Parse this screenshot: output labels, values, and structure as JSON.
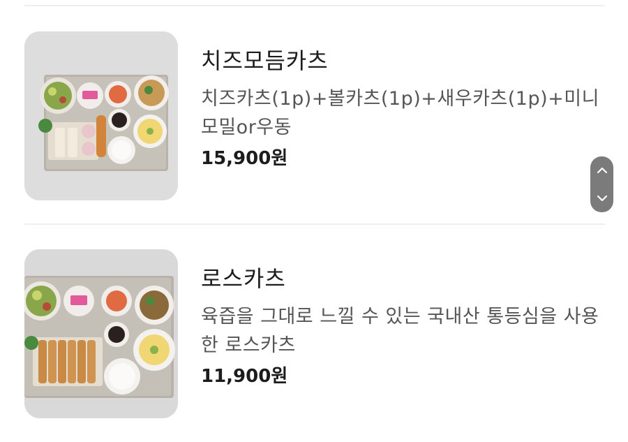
{
  "menu": {
    "items": [
      {
        "name": "치즈모듬카츠",
        "description": "치즈카츠(1p)+볼카츠(1p)+새우카츠(1p)+미니모밀or우동",
        "price": "15,900원",
        "image_icon": "cheese-katsu-set-photo"
      },
      {
        "name": "로스카츠",
        "description": "육즙을 그대로 느낄 수 있는 국내산 통등심을 사용한 로스카츠",
        "price": "11,900원",
        "image_icon": "ros-katsu-set-photo"
      }
    ]
  },
  "scroll_control": {
    "up_icon": "chevron-up-icon",
    "down_icon": "chevron-down-icon",
    "color": "#7b7b7b"
  }
}
